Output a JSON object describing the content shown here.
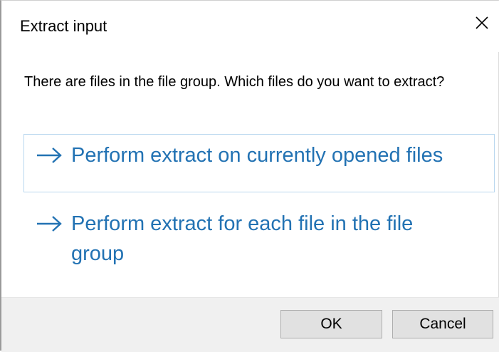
{
  "window": {
    "title": "Extract input",
    "close_icon": "close-icon"
  },
  "prompt": "There are files in the file group. Which files do you want to extract?",
  "options": [
    {
      "label": "Perform extract on currently opened files",
      "icon": "arrow-right-icon"
    },
    {
      "label": "Perform extract for each file in the file group",
      "icon": "arrow-right-icon"
    }
  ],
  "buttons": {
    "ok": "OK",
    "cancel": "Cancel"
  },
  "colors": {
    "link_text": "#2272b3",
    "footer_bg": "#f0f0f0",
    "button_bg": "#e1e1e1",
    "highlight_border": "#b9d7ef"
  }
}
